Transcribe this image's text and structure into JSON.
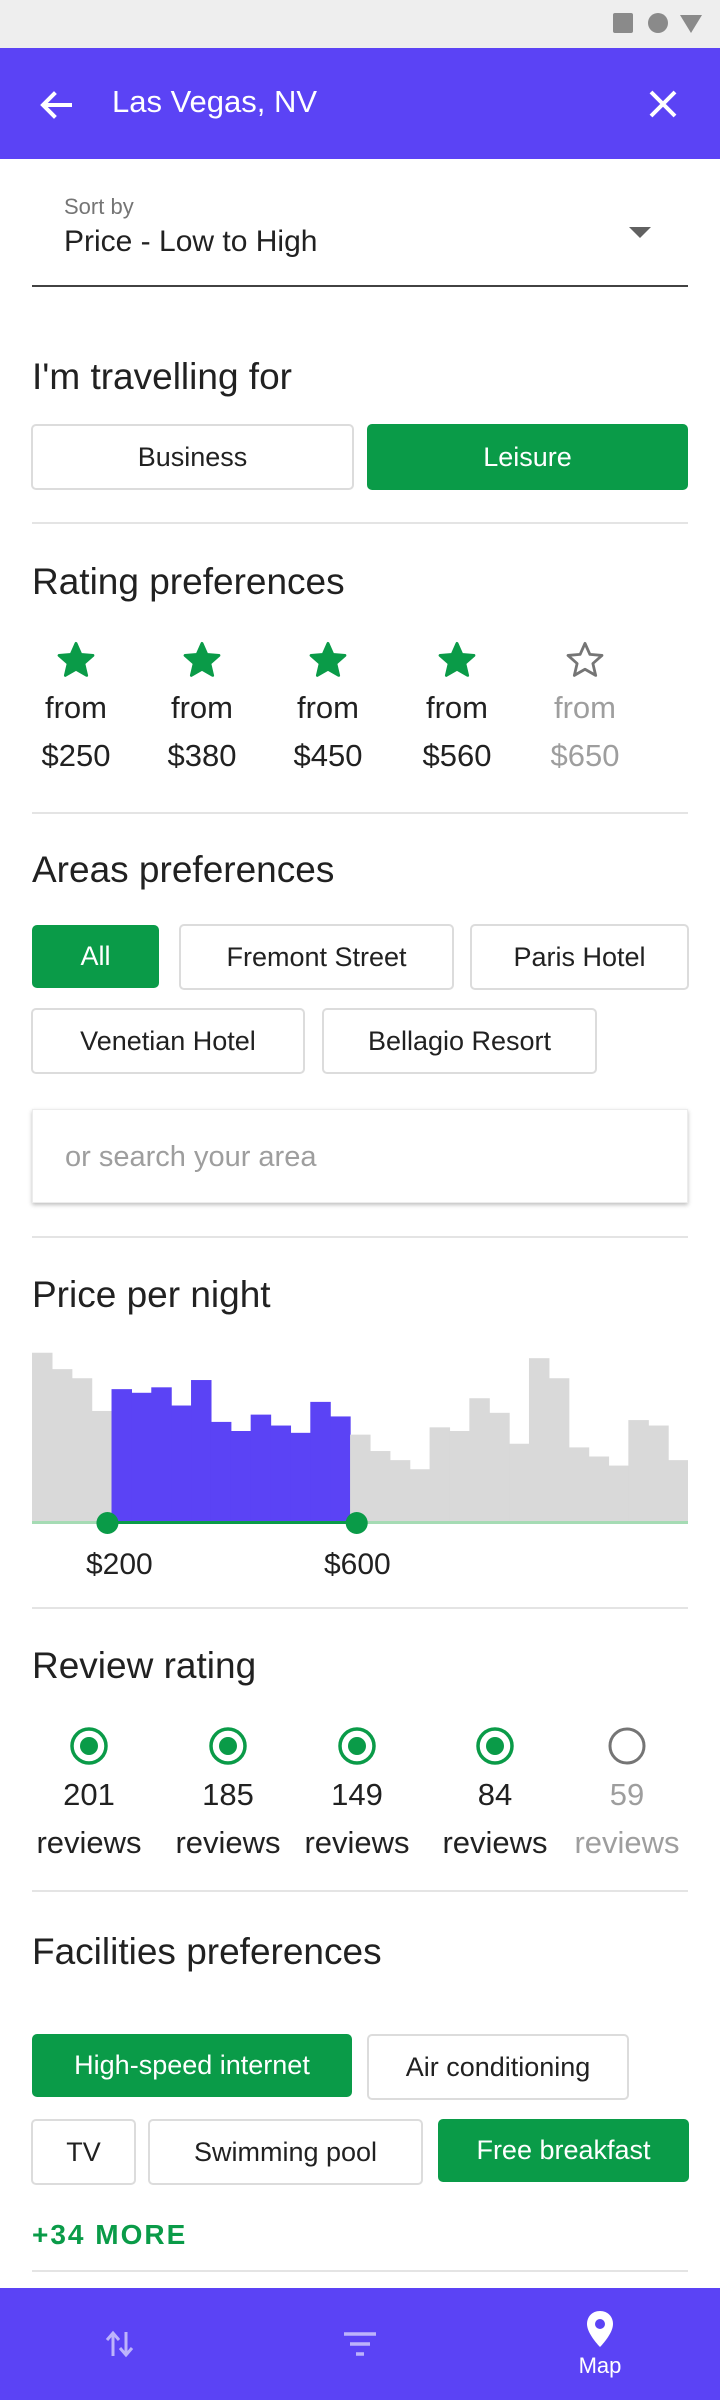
{
  "app_bar": {
    "title": "Las Vegas, NV",
    "back_icon": "arrow-back-icon",
    "close_icon": "close-icon",
    "color": "#5b43f5"
  },
  "sort": {
    "label": "Sort by",
    "value": "Price - Low to High"
  },
  "travel": {
    "heading": "I'm travelling for",
    "options": [
      {
        "label": "Business",
        "selected": false
      },
      {
        "label": "Leisure",
        "selected": true
      }
    ]
  },
  "rating": {
    "heading": "Rating preferences",
    "items": [
      {
        "from": "from",
        "price": "$250",
        "active": true
      },
      {
        "from": "from",
        "price": "$380",
        "active": true
      },
      {
        "from": "from",
        "price": "$450",
        "active": true
      },
      {
        "from": "from",
        "price": "$560",
        "active": true
      },
      {
        "from": "from",
        "price": "$650",
        "active": false
      }
    ]
  },
  "areas": {
    "heading": "Areas preferences",
    "chips": [
      {
        "label": "All",
        "selected": true
      },
      {
        "label": "Fremont Street",
        "selected": false
      },
      {
        "label": "Paris Hotel",
        "selected": false
      },
      {
        "label": "Venetian Hotel",
        "selected": false
      },
      {
        "label": "Bellagio Resort",
        "selected": false
      }
    ],
    "search_placeholder": "or search your area"
  },
  "price": {
    "heading": "Price per night",
    "min_label": "$200",
    "max_label": "$600",
    "histogram": [
      0.93,
      0.84,
      0.79,
      0.61,
      0.73,
      0.71,
      0.74,
      0.64,
      0.78,
      0.55,
      0.5,
      0.59,
      0.53,
      0.49,
      0.66,
      0.58,
      0.48,
      0.39,
      0.34,
      0.29,
      0.52,
      0.5,
      0.68,
      0.6,
      0.43,
      0.9,
      0.79,
      0.41,
      0.36,
      0.31,
      0.56,
      0.53,
      0.34
    ],
    "selected_range": [
      0.115,
      0.495
    ],
    "colors": {
      "selected": "#5b43f5",
      "unselected": "#d9d9d9",
      "track": "#a5dbb4",
      "handle": "#0a9b48"
    }
  },
  "reviews": {
    "heading": "Review rating",
    "items": [
      {
        "count": "201",
        "unit": "reviews",
        "selected": true
      },
      {
        "count": "185",
        "unit": "reviews",
        "selected": true
      },
      {
        "count": "149",
        "unit": "reviews",
        "selected": true
      },
      {
        "count": "84",
        "unit": "reviews",
        "selected": true
      },
      {
        "count": "59",
        "unit": "reviews",
        "selected": false
      }
    ]
  },
  "facilities": {
    "heading": "Facilities preferences",
    "chips": [
      {
        "label": "High-speed internet",
        "selected": true
      },
      {
        "label": "Air conditioning",
        "selected": false
      },
      {
        "label": "TV",
        "selected": false
      },
      {
        "label": "Swimming pool",
        "selected": false
      },
      {
        "label": "Free breakfast",
        "selected": true
      }
    ],
    "more_label": "+34 MORE"
  },
  "bottom_nav": {
    "items": [
      {
        "icon": "sort-arrows-icon",
        "label": ""
      },
      {
        "icon": "filter-icon",
        "label": ""
      },
      {
        "icon": "map-pin-icon",
        "label": "Map"
      }
    ]
  },
  "accent_green": "#0a9b48"
}
